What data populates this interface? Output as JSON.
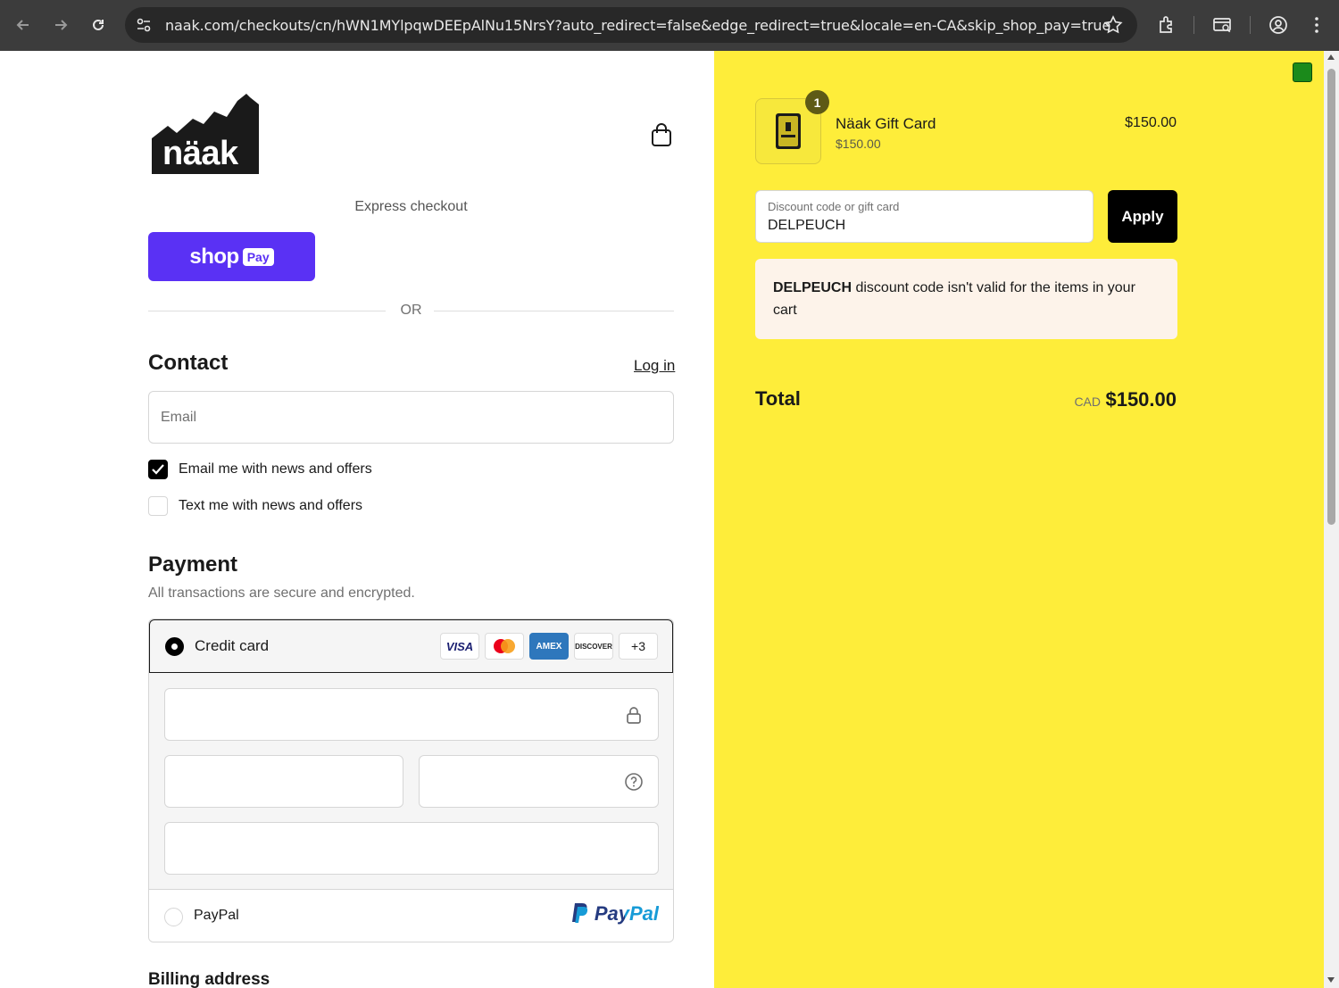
{
  "browser": {
    "url": "naak.com/checkouts/cn/hWN1MYlpqwDEEpAlNu15NrsY?auto_redirect=false&edge_redirect=true&locale=en-CA&skip_shop_pay=true",
    "icons": [
      "back-icon",
      "forward-icon",
      "reload-icon",
      "site-info-icon",
      "bookmark-star-icon",
      "extensions-icon",
      "tab-search-icon",
      "profile-icon",
      "menu-icon"
    ]
  },
  "header": {
    "logo_text": "näak",
    "cart_icon": "shopping-bag-icon"
  },
  "express": {
    "label": "Express checkout",
    "shoppay_word": "shop",
    "shoppay_pay": "Pay",
    "or": "OR"
  },
  "contact": {
    "title": "Contact",
    "login": "Log in",
    "email_placeholder": "Email",
    "email_news": "Email me with news and offers",
    "email_news_checked": true,
    "text_news": "Text me with news and offers",
    "text_news_checked": false
  },
  "payment": {
    "title": "Payment",
    "subtitle": "All transactions are secure and encrypted.",
    "credit_card_label": "Credit card",
    "card_brands": [
      "VISA",
      "Mastercard",
      "AMEX",
      "DISCOVER",
      "+3"
    ],
    "paypal_label": "PayPal",
    "paypal_logo": "PayPal",
    "selected": "credit_card"
  },
  "billing": {
    "title": "Billing address"
  },
  "summary": {
    "item": {
      "name": "Näak Gift Card",
      "sub_price": "$150.00",
      "price": "$150.00",
      "quantity": "1"
    },
    "discount_placeholder": "Discount code or gift card",
    "discount_value": "DELPEUCH",
    "apply_label": "Apply",
    "error_code": "DELPEUCH",
    "error_message": " discount code isn't valid for the items in your cart",
    "total_label": "Total",
    "currency": "CAD",
    "total": "$150.00"
  },
  "colors": {
    "accent_shop_pay": "#5a31f4",
    "summary_bg": "#feed3a",
    "error_bg": "#fdf3ea",
    "button_bg": "#000000"
  }
}
